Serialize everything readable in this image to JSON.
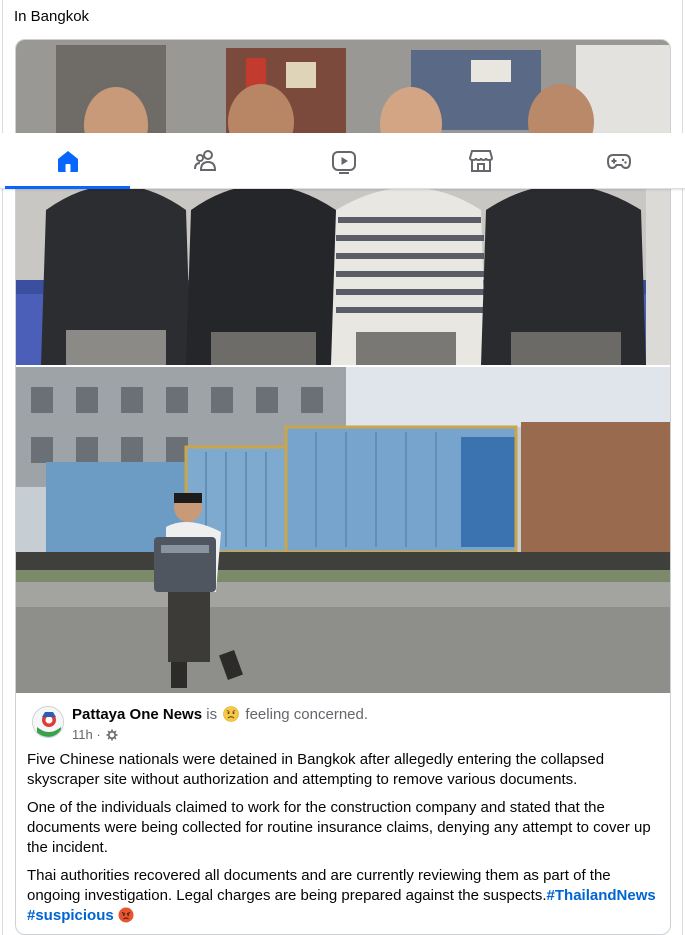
{
  "location_text": "In Bangkok",
  "tabs": [
    {
      "icon": "home-icon",
      "active": true
    },
    {
      "icon": "friends-icon",
      "active": false
    },
    {
      "icon": "video-icon",
      "active": false
    },
    {
      "icon": "marketplace-icon",
      "active": false
    },
    {
      "icon": "gaming-icon",
      "active": false
    }
  ],
  "post": {
    "author": "Pattaya One News",
    "activity_prefix": "is",
    "activity": "feeling concerned.",
    "time": "11h",
    "separator": "·",
    "privacy_icon": "settings-gear-icon",
    "paragraphs": {
      "p1": "Five Chinese nationals were detained in Bangkok after allegedly entering the collapsed skyscraper site without authorization and attempting to remove various documents.",
      "p2": "One of the individuals claimed to work for the construction company and stated that the documents were being collected for routine insurance claims, denying any attempt to cover up the incident.",
      "p3": "Thai authorities recovered all documents and are currently reviewing them as part of the ongoing investigation. Legal charges are being prepared against the suspects."
    },
    "hashtags": [
      "#ThailandNews",
      "#suspicious"
    ]
  },
  "colors": {
    "accent": "#0866ff",
    "hashtag": "#0064d1",
    "secondary_text": "#65676b"
  }
}
